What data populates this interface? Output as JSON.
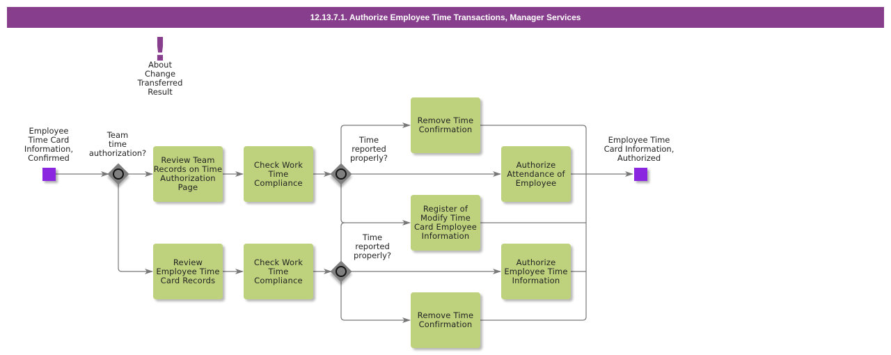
{
  "header": {
    "title": "12.13.7.1. Authorize Employee Time Transactions, Manager Services"
  },
  "colors": {
    "header": "#873e8c",
    "task": "#bed17d",
    "event": "#8a25e0",
    "gateway": "#7f7f7f",
    "flow": "#6f6f6f"
  },
  "annotation": {
    "icon": "exclamation-icon",
    "glyph": "!",
    "label": "About\nChange\nTransferred\nResult"
  },
  "start_event": {
    "label": "Employee\nTime Card\nInformation,\nConfirmed"
  },
  "end_event": {
    "label": "Employee Time\nCard Information,\nAuthorized"
  },
  "gateways": [
    {
      "id": "g1",
      "label": "Team\ntime\nauthorization?"
    },
    {
      "id": "g2",
      "label": "Time\nreported\nproperly?"
    },
    {
      "id": "g3",
      "label": "Time\nreported\nproperly?"
    }
  ],
  "tasks": [
    {
      "id": "t1",
      "label": "Review Team\nRecords on Time\nAuthorization\nPage"
    },
    {
      "id": "t2",
      "label": "Check Work\nTime\nCompliance"
    },
    {
      "id": "t3",
      "label": "Remove Time\nConfirmation"
    },
    {
      "id": "t4",
      "label": "Authorize\nAttendance of\nEmployee"
    },
    {
      "id": "t5",
      "label": "Register of\nModify Time\nCard Employee\nInformation"
    },
    {
      "id": "t6",
      "label": "Review\nEmployee Time\nCard Records"
    },
    {
      "id": "t7",
      "label": "Check Work\nTime\nCompliance"
    },
    {
      "id": "t8",
      "label": "Authorize\nEmployee Time\nInformation"
    },
    {
      "id": "t9",
      "label": "Remove Time\nConfirmation"
    }
  ]
}
